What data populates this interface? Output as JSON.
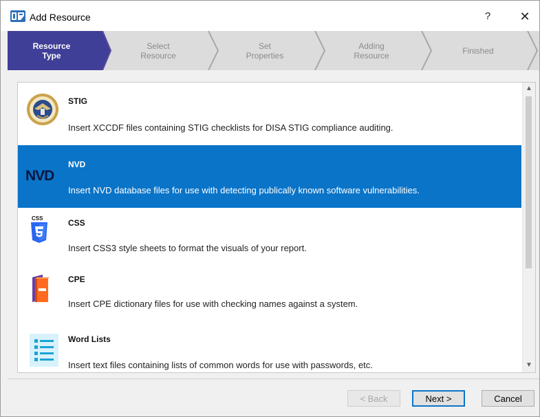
{
  "window": {
    "title": "Add Resource",
    "help_label": "?",
    "close_label": "✕"
  },
  "steps": [
    {
      "line1": "Resource",
      "line2": "Type",
      "active": true
    },
    {
      "line1": "Select",
      "line2": "Resource",
      "active": false
    },
    {
      "line1": "Set",
      "line2": "Properties",
      "active": false
    },
    {
      "line1": "Adding",
      "line2": "Resource",
      "active": false
    },
    {
      "line1": "Finished",
      "line2": "",
      "active": false
    }
  ],
  "resources": [
    {
      "title": "STIG",
      "description": "Insert XCCDF files containing STIG checklists for DISA STIG compliance auditing.",
      "icon": "disa-seal-icon",
      "selected": false
    },
    {
      "title": "NVD",
      "description": "Insert NVD database files for use with detecting publically known software vulnerabilities.",
      "icon": "nvd-logo-icon",
      "icon_text": "NVD",
      "selected": true
    },
    {
      "title": "CSS",
      "description": "Insert CSS3 style sheets to format the visuals of your report.",
      "icon": "css3-icon",
      "icon_text": "CSS",
      "selected": false
    },
    {
      "title": "CPE",
      "description": "Insert CPE dictionary files for use with checking names against a system.",
      "icon": "book-icon",
      "selected": false
    },
    {
      "title": "Word Lists",
      "description": "Insert text files containing lists of common words for use with passwords, etc.",
      "icon": "list-icon",
      "selected": false
    }
  ],
  "buttons": {
    "back": "< Back",
    "next": "Next >",
    "cancel": "Cancel"
  },
  "colors": {
    "accent": "#0a74c8",
    "active_step": "#3f3f97"
  }
}
